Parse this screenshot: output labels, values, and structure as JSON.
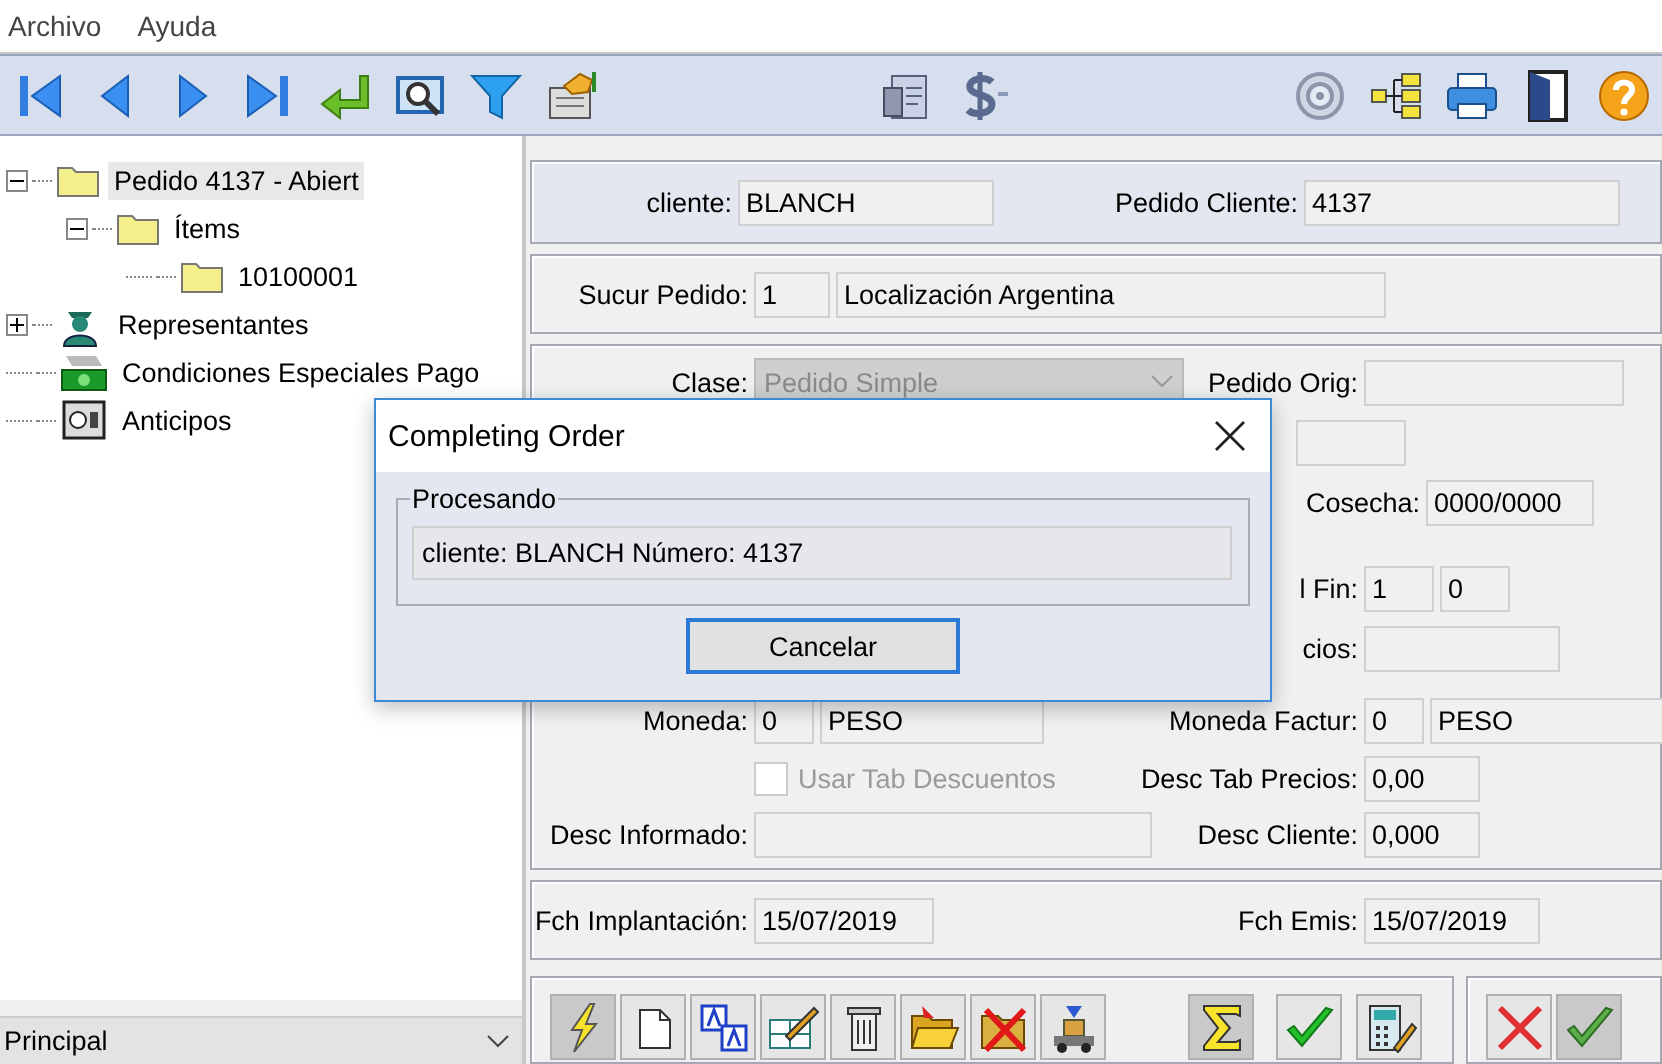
{
  "menu": [
    "Archivo",
    "Ayuda"
  ],
  "tree": [
    {
      "label": "Pedido 4137 - Abiert",
      "expanded": true,
      "selected": true,
      "children": [
        {
          "label": "Ítems",
          "expanded": true,
          "selected": false,
          "children": [
            {
              "label": "10100001",
              "selected": false
            }
          ]
        }
      ]
    },
    {
      "label": "Representantes",
      "expanded": false,
      "selected": false
    },
    {
      "label": "Condiciones Especiales Pago",
      "selected": false
    },
    {
      "label": "Anticipos",
      "selected": false
    }
  ],
  "view_select": {
    "value": "Principal"
  },
  "sections": [
    {
      "rows": [
        {
          "left": {
            "label": "cliente:",
            "fields": [
              {
                "kind": "field",
                "value": "BLANCH"
              }
            ]
          },
          "right": {
            "label": "Pedido Cliente:",
            "fields": [
              {
                "kind": "field",
                "value": "4137"
              }
            ]
          }
        }
      ]
    },
    {
      "rows": [
        {
          "left": {
            "label": "Sucur Pedido:",
            "fields": [
              {
                "kind": "field",
                "value": "1"
              },
              {
                "kind": "field",
                "value": "Localización Argentina"
              }
            ]
          }
        }
      ]
    },
    {
      "rows": [
        {
          "left": {
            "label": "Clase:",
            "fields": [
              {
                "kind": "dropdown",
                "value": "Pedido Simple",
                "disabled": true
              }
            ]
          },
          "right": {
            "label": "Pedido Orig:",
            "fields": [
              {
                "kind": "field"
              }
            ]
          }
        },
        {
          "right": {
            "fields": [
              {
                "kind": "field"
              }
            ]
          }
        },
        {
          "right": {
            "label": "Cosecha:",
            "fields": [
              {
                "kind": "field",
                "value": "0000/0000"
              }
            ]
          }
        },
        {
          "right": {
            "label": "l Fin:",
            "fields": [
              {
                "kind": "field",
                "value": "1"
              },
              {
                "kind": "field",
                "value": "0"
              }
            ]
          }
        },
        {
          "right": {
            "label": "cios:",
            "fields": [
              {
                "kind": "field"
              }
            ]
          }
        },
        {
          "left": {
            "label": "Moneda:",
            "fields": [
              {
                "kind": "field",
                "value": "0"
              },
              {
                "kind": "field",
                "value": "PESO"
              }
            ]
          },
          "right": {
            "label": "Moneda Factur:",
            "fields": [
              {
                "kind": "field",
                "value": "0"
              },
              {
                "kind": "field",
                "value": "PESO"
              }
            ]
          }
        },
        {
          "left": {
            "fields": [
              {
                "kind": "checkbox",
                "label": "Usar Tab Descuentos",
                "checked": false,
                "disabled": true
              }
            ]
          },
          "right": {
            "label": "Desc Tab Precios:",
            "fields": [
              {
                "kind": "field",
                "value": "0,00"
              }
            ]
          }
        },
        {
          "left": {
            "label": "Desc Informado:",
            "fields": [
              {
                "kind": "field"
              }
            ]
          },
          "right": {
            "label": "Desc Cliente:",
            "fields": [
              {
                "kind": "field",
                "value": "0,000"
              }
            ]
          }
        }
      ]
    },
    {
      "rows": [
        {
          "left": {
            "label": "Fch Implantación:",
            "fields": [
              {
                "kind": "field",
                "value": "15/07/2019"
              }
            ]
          },
          "right": {
            "label": "Fch Emis:",
            "fields": [
              {
                "kind": "field",
                "value": "15/07/2019"
              }
            ]
          }
        }
      ]
    }
  ],
  "bottom_toolbar": [
    {
      "buttons": [
        {
          "pressed": true
        },
        {
          "pressed": false
        },
        {
          "pressed": false
        },
        {
          "pressed": false
        },
        {
          "pressed": false
        },
        {
          "pressed": false
        },
        {
          "pressed": false
        },
        {
          "pressed": false
        },
        {
          "pressed": true
        },
        {
          "pressed": false
        },
        {
          "pressed": false
        }
      ]
    },
    {
      "buttons": [
        {
          "pressed": false
        },
        {
          "pressed": true
        }
      ]
    }
  ],
  "dialog": {
    "title": "Completing Order",
    "group": "Procesando",
    "message": "cliente: BLANCH Número: 4137",
    "button": "Cancelar"
  }
}
